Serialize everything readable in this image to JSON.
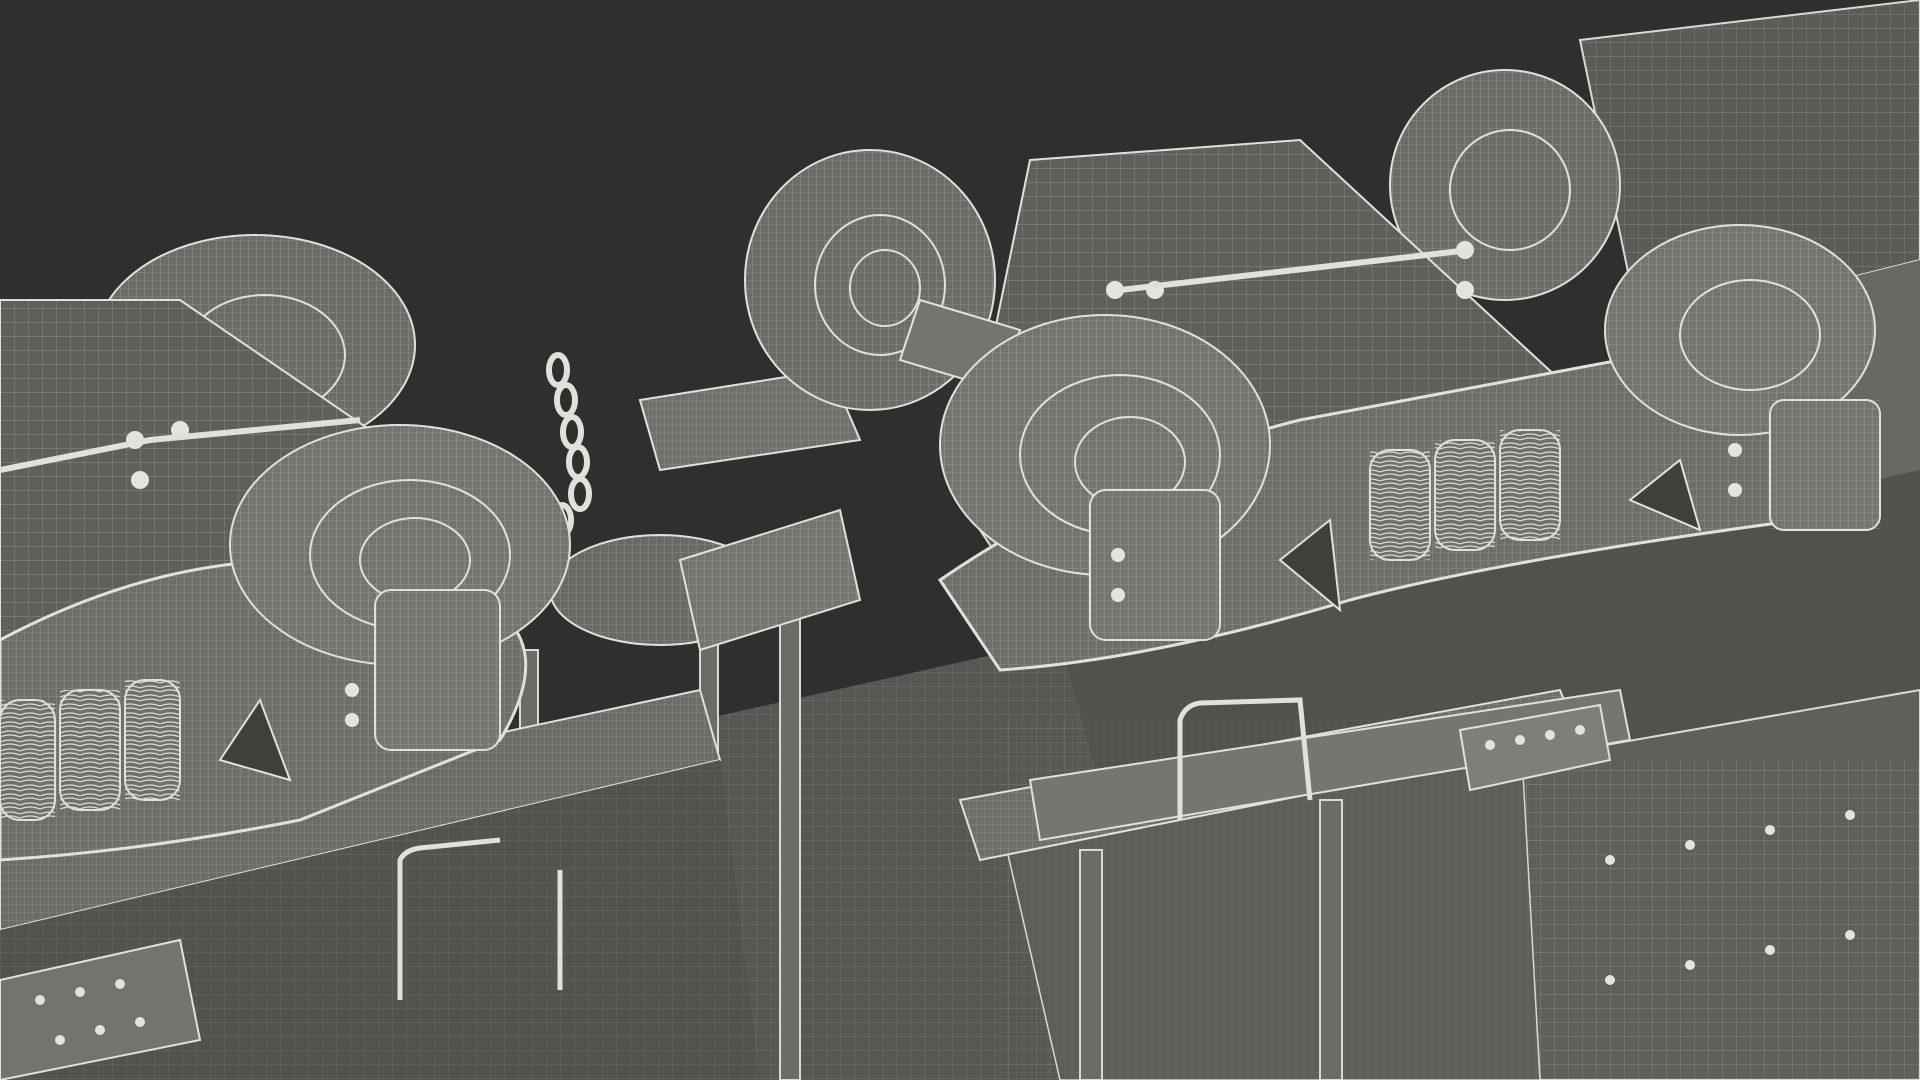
{
  "scene": {
    "subject": "wireframe-3d-render",
    "colors": {
      "background": "#2f302e",
      "wire": "#d9dad3",
      "surface": "#5f625c",
      "surface_dark": "#4a4c47",
      "surface_light": "#7a7d76"
    }
  }
}
